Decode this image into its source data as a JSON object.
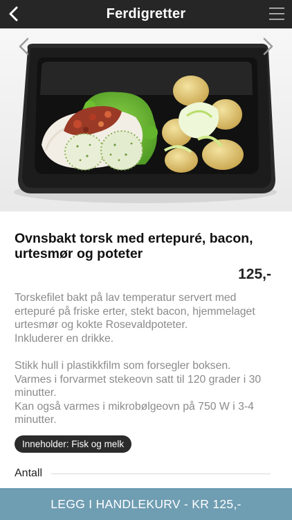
{
  "header": {
    "title": "Ferdigretter",
    "back_icon": "chevron-left-icon",
    "menu_icon": "hamburger-menu-icon"
  },
  "gallery": {
    "prev_icon": "chevron-left-icon",
    "next_icon": "chevron-right-icon",
    "image_subject": "food-in-black-tray"
  },
  "product": {
    "title": "Ovnsbakt torsk med ertepuré, bacon, urtesmør og poteter",
    "price": "125,-",
    "description": [
      "Torskefilet bakt på lav temperatur servert med ertepuré på friske erter, stekt bacon, hjemmelaget urtesmør og kokte Rosevaldpoteter.",
      "Inkluderer en drikke.",
      "",
      "Stikk hull i plastikkfilm som forsegler boksen.",
      "Varmes i forvarmet stekeovn satt til 120 grader i 30 minutter.",
      "Kan også varmes i mikrobølgeovn på 750 W i 3-4 minutter."
    ],
    "allergen_badge": "Inneholder: Fisk og melk",
    "quantity_label": "Antall"
  },
  "cart": {
    "button_label": "LEGG I HANDLEKURV - KR 125,-"
  },
  "colors": {
    "topbar": "#262626",
    "cart_button": "#6f9db2",
    "badge": "#2b2b2b",
    "description_text": "#8a8a8a"
  }
}
